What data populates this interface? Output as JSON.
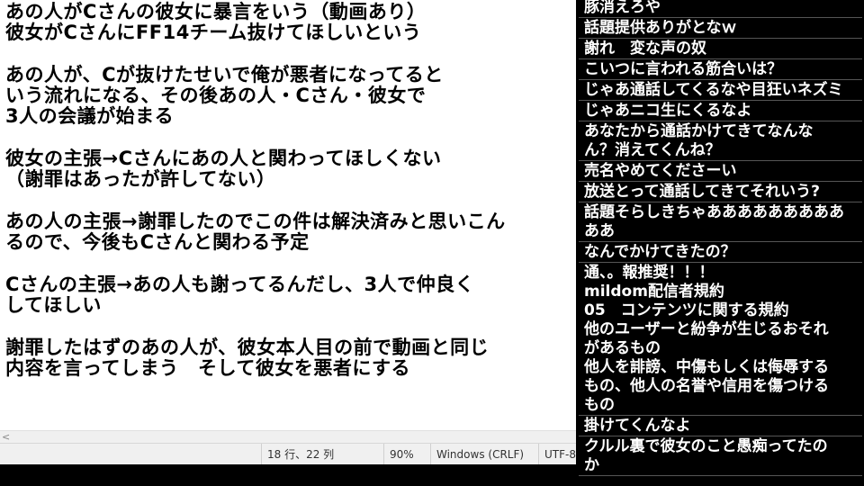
{
  "editor": {
    "lines": [
      "あの人がCさんの彼女に暴言をいう（動画あり）",
      "彼女がCさんにFF14チーム抜けてほしいという",
      "",
      "あの人が、Cが抜けたせいで俺が悪者になってると",
      "いう流れになる、その後あの人・Cさん・彼女で",
      "3人の会議が始まる",
      "",
      "彼女の主張→Cさんにあの人と関わってほしくない",
      "（謝罪はあったが許してない）",
      "",
      "あの人の主張→謝罪したのでこの件は解決済みと思いこん",
      "るので、今後もCさんと関わる予定",
      "",
      "Cさんの主張→あの人も謝ってるんだし、3人で仲良く",
      "してほしい",
      "",
      "謝罪したはずのあの人が、彼女本人目の前で動画と同じ",
      "内容を言ってしまう　そして彼女を悪者にする"
    ]
  },
  "scrollbar": {
    "left_arrow": "<"
  },
  "status": {
    "position": "18 行、22 列",
    "zoom": "90%",
    "line_ending": "Windows (CRLF)",
    "encoding": "UTF-8"
  },
  "comments": [
    "豚消えろや",
    "話題提供ありがとなｗ",
    "謝れ　変な声の奴",
    "こいつに言われる筋合いは？",
    "じゃあ通話してくるなや目狂いネズミ",
    "じゃあニコ生にくるなよ",
    "あなたから通話かけてきてなんな\nん？消えてくんね？",
    "売名やめてくださーい",
    "放送とって通話してきてそれいう?",
    "話題そらしきちゃあああああああああ\nああ",
    "なんでかけてきたの？",
    "通、。報推奨！！！\nmildom配信者規約\n05　コンテンツに関する規約\n他のユーザーと紛争が生じるおそれ\nがあるもの\n他人を誹謗、中傷もしくは侮辱する\nもの、他人の名誉や信用を傷つける\nもの",
    "掛けてくんなよ",
    "クルル裏で彼女のこと愚痴ってたの\nか"
  ]
}
